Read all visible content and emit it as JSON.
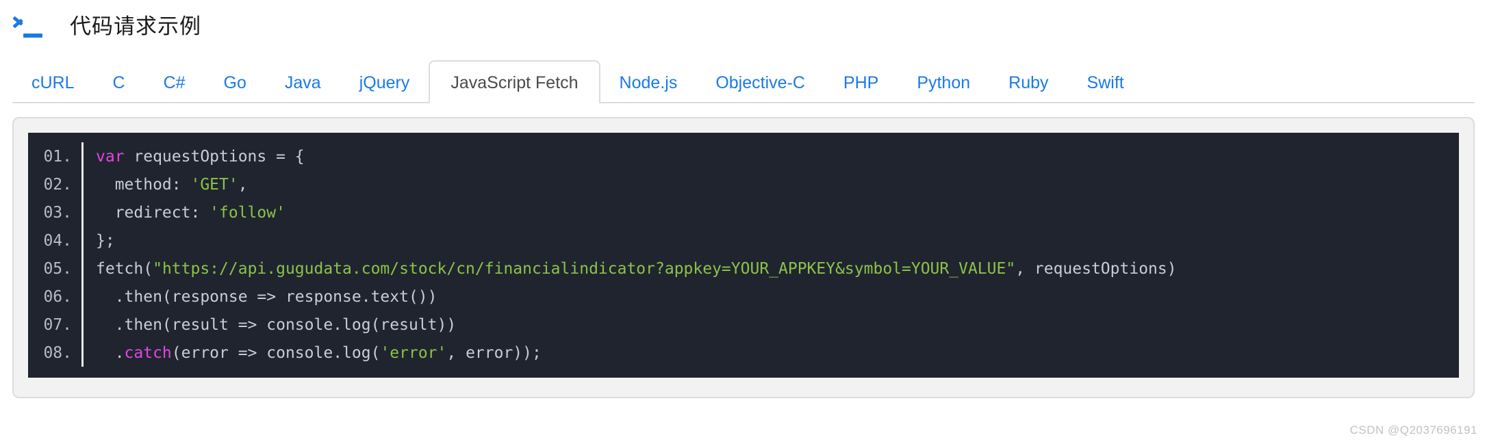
{
  "header": {
    "icon": "terminal-prompt-icon",
    "title": "代码请求示例"
  },
  "tabs": {
    "active_index": 6,
    "items": [
      {
        "label": "cURL"
      },
      {
        "label": "C"
      },
      {
        "label": "C#"
      },
      {
        "label": "Go"
      },
      {
        "label": "Java"
      },
      {
        "label": "jQuery"
      },
      {
        "label": "JavaScript Fetch"
      },
      {
        "label": "Node.js"
      },
      {
        "label": "Objective-C"
      },
      {
        "label": "PHP"
      },
      {
        "label": "Python"
      },
      {
        "label": "Ruby"
      },
      {
        "label": "Swift"
      }
    ]
  },
  "code": {
    "language": "JavaScript Fetch",
    "lines": [
      {
        "number": "01.",
        "tokens": [
          {
            "t": "var",
            "c": "kw"
          },
          {
            "t": " requestOptions = {",
            "c": "pl"
          }
        ]
      },
      {
        "number": "02.",
        "tokens": [
          {
            "t": "  method: ",
            "c": "pl"
          },
          {
            "t": "'GET'",
            "c": "str"
          },
          {
            "t": ",",
            "c": "pl"
          }
        ]
      },
      {
        "number": "03.",
        "tokens": [
          {
            "t": "  redirect: ",
            "c": "pl"
          },
          {
            "t": "'follow'",
            "c": "str"
          }
        ]
      },
      {
        "number": "04.",
        "tokens": [
          {
            "t": "};",
            "c": "pl"
          }
        ]
      },
      {
        "number": "05.",
        "tokens": [
          {
            "t": "fetch(",
            "c": "pl"
          },
          {
            "t": "\"https://api.gugudata.com/stock/cn/financialindicator?appkey=YOUR_APPKEY&symbol=YOUR_VALUE\"",
            "c": "str"
          },
          {
            "t": ", requestOptions)",
            "c": "pl"
          }
        ]
      },
      {
        "number": "06.",
        "tokens": [
          {
            "t": "  .then(response => response.text())",
            "c": "pl"
          }
        ]
      },
      {
        "number": "07.",
        "tokens": [
          {
            "t": "  .then(result => console.log(result))",
            "c": "pl"
          }
        ]
      },
      {
        "number": "08.",
        "tokens": [
          {
            "t": "  .",
            "c": "pl"
          },
          {
            "t": "catch",
            "c": "kw"
          },
          {
            "t": "(error => console.log(",
            "c": "pl"
          },
          {
            "t": "'error'",
            "c": "str"
          },
          {
            "t": ", error));",
            "c": "pl"
          }
        ]
      }
    ]
  },
  "watermark": {
    "text": "CSDN @Q2037696191"
  },
  "colors": {
    "link_blue": "#1a7ae8",
    "code_bg": "#20242e",
    "card_bg": "#f2f2f2",
    "border": "#dcdcdc",
    "keyword": "#e246e2",
    "string": "#8bc34a",
    "plain": "#c8cdd6"
  }
}
